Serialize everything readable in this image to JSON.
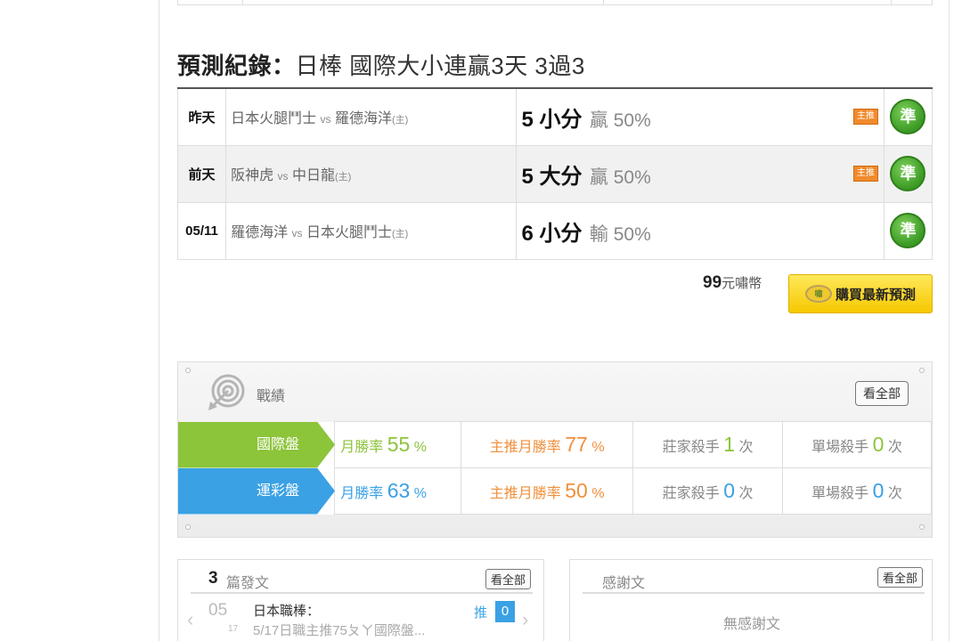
{
  "record": {
    "title_label": "預測紀錄：",
    "title_rest": "日棒 國際大小連贏3天 3過3",
    "rows": [
      {
        "date": "昨天",
        "home": "日本火腿鬥士",
        "vs": "vs",
        "away": "羅德海洋",
        "host": "(主)",
        "pick": "5 小分",
        "result": "贏 50%",
        "tag": "主推",
        "badge": "準"
      },
      {
        "date": "前天",
        "home": "阪神虎",
        "vs": "vs",
        "away": "中日龍",
        "host": "(主)",
        "pick": "5 大分",
        "result": "贏 50%",
        "tag": "主推",
        "badge": "準"
      },
      {
        "date": "05/11",
        "home": "羅德海洋",
        "vs": "vs",
        "away": "日本火腿鬥士",
        "host": "(主)",
        "pick": "6 小分",
        "result": "輸 50%",
        "tag": "",
        "badge": "準"
      }
    ]
  },
  "buy": {
    "price": "99",
    "currency": "元嘯幣",
    "coin": "嘯",
    "button": "購買最新預測"
  },
  "perf": {
    "title": "戰績",
    "view_all": "看全部",
    "rows": [
      {
        "label": "國際盤",
        "mwr_label": "月勝率",
        "mwr": "55",
        "hwr_label": "主推月勝率",
        "hwr": "77",
        "pct": "%",
        "bk_label": "莊家殺手",
        "bk": "1",
        "sg_label": "單場殺手",
        "sg": "0",
        "times": "次"
      },
      {
        "label": "運彩盤",
        "mwr_label": "月勝率",
        "mwr": "63",
        "hwr_label": "主推月勝率",
        "hwr": "50",
        "pct": "%",
        "bk_label": "莊家殺手",
        "bk": "0",
        "sg_label": "單場殺手",
        "sg": "0",
        "times": "次"
      }
    ]
  },
  "posts": {
    "count": "3",
    "count_label": "篇發文",
    "view_all": "看全部",
    "item": {
      "month": "05",
      "day": "17",
      "title": "日本職棒：",
      "sub": "5/17日職主推75ㄆㄚ國際盤...",
      "push_label": "推",
      "push_count": "0"
    }
  },
  "thanks": {
    "title": "感謝文",
    "view_all": "看全部",
    "empty": "無感謝文"
  },
  "colors": {
    "green": "#8cc43a",
    "blue": "#3aa1e4",
    "orange": "#f0903c",
    "gold": "#f5c800"
  }
}
